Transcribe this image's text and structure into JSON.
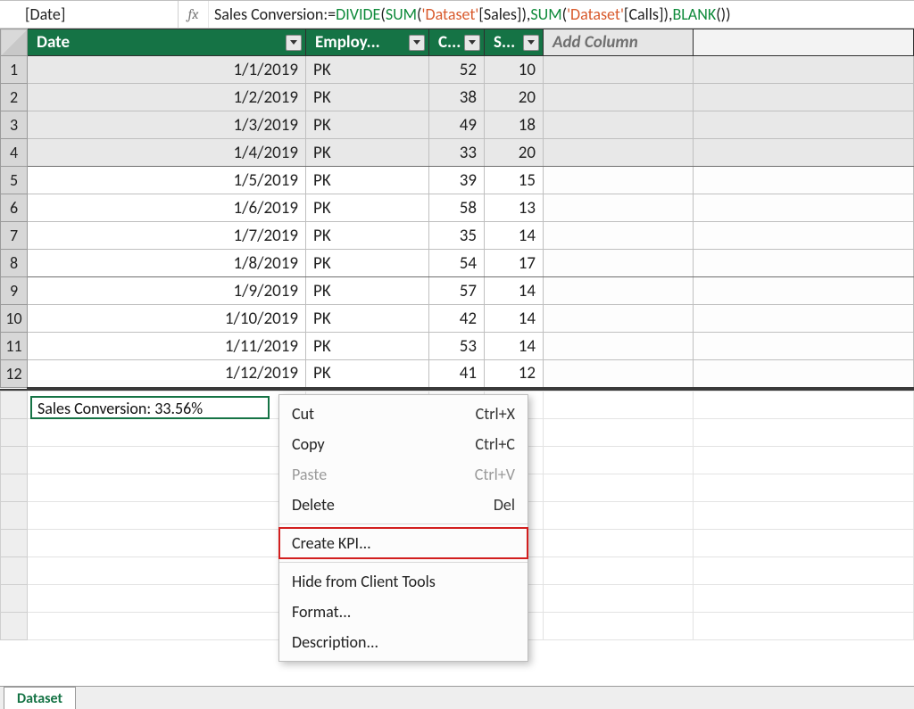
{
  "formula_bar": {
    "name_box": "[Date]",
    "fx_label": "fx",
    "formula_tokens": [
      {
        "t": "name",
        "v": "Sales Conversion:"
      },
      {
        "t": "op",
        "v": "="
      },
      {
        "t": "fn",
        "v": "DIVIDE"
      },
      {
        "t": "op",
        "v": "("
      },
      {
        "t": "fn",
        "v": "SUM"
      },
      {
        "t": "op",
        "v": "("
      },
      {
        "t": "lit",
        "v": "'Dataset'"
      },
      {
        "t": "op",
        "v": "["
      },
      {
        "t": "name",
        "v": "Sales"
      },
      {
        "t": "op",
        "v": "]),"
      },
      {
        "t": "fn",
        "v": "SUM"
      },
      {
        "t": "op",
        "v": "("
      },
      {
        "t": "lit",
        "v": "'Dataset'"
      },
      {
        "t": "op",
        "v": "["
      },
      {
        "t": "name",
        "v": "Calls"
      },
      {
        "t": "op",
        "v": "]),"
      },
      {
        "t": "fn",
        "v": "BLANK"
      },
      {
        "t": "op",
        "v": "())"
      }
    ]
  },
  "columns": {
    "date": {
      "label": "Date"
    },
    "employ": {
      "label": "Employ..."
    },
    "c": {
      "label": "C..."
    },
    "s": {
      "label": "S..."
    },
    "add": {
      "label": "Add Column"
    }
  },
  "rows": [
    {
      "n": "1",
      "date": "1/1/2019",
      "emp": "PK",
      "c": "52",
      "s": "10",
      "shade": true
    },
    {
      "n": "2",
      "date": "1/2/2019",
      "emp": "PK",
      "c": "38",
      "s": "20",
      "shade": true
    },
    {
      "n": "3",
      "date": "1/3/2019",
      "emp": "PK",
      "c": "49",
      "s": "18",
      "shade": true
    },
    {
      "n": "4",
      "date": "1/4/2019",
      "emp": "PK",
      "c": "33",
      "s": "20",
      "shade": true,
      "sep": true
    },
    {
      "n": "5",
      "date": "1/5/2019",
      "emp": "PK",
      "c": "39",
      "s": "15"
    },
    {
      "n": "6",
      "date": "1/6/2019",
      "emp": "PK",
      "c": "58",
      "s": "13"
    },
    {
      "n": "7",
      "date": "1/7/2019",
      "emp": "PK",
      "c": "35",
      "s": "14"
    },
    {
      "n": "8",
      "date": "1/8/2019",
      "emp": "PK",
      "c": "54",
      "s": "17",
      "sep": true
    },
    {
      "n": "9",
      "date": "1/9/2019",
      "emp": "PK",
      "c": "57",
      "s": "14"
    },
    {
      "n": "10",
      "date": "1/10/2019",
      "emp": "PK",
      "c": "42",
      "s": "14"
    },
    {
      "n": "11",
      "date": "1/11/2019",
      "emp": "PK",
      "c": "53",
      "s": "14"
    },
    {
      "n": "12",
      "date": "1/12/2019",
      "emp": "PK",
      "c": "41",
      "s": "12"
    }
  ],
  "measure": {
    "display": "Sales Conversion: 33.56%"
  },
  "context_menu": {
    "items": [
      {
        "label": "Cut",
        "shortcut": "Ctrl+X",
        "enabled": true
      },
      {
        "label": "Copy",
        "shortcut": "Ctrl+C",
        "enabled": true
      },
      {
        "label": "Paste",
        "shortcut": "Ctrl+V",
        "enabled": false
      },
      {
        "label": "Delete",
        "shortcut": "Del",
        "enabled": true
      },
      {
        "sep": true
      },
      {
        "label": "Create KPI...",
        "shortcut": "",
        "enabled": true,
        "highlight": true
      },
      {
        "sep": true
      },
      {
        "label": "Hide from Client Tools",
        "shortcut": "",
        "enabled": true
      },
      {
        "label": "Format...",
        "shortcut": "",
        "enabled": true
      },
      {
        "label": "Description...",
        "shortcut": "",
        "enabled": true
      }
    ]
  },
  "tab": {
    "label": "Dataset"
  }
}
